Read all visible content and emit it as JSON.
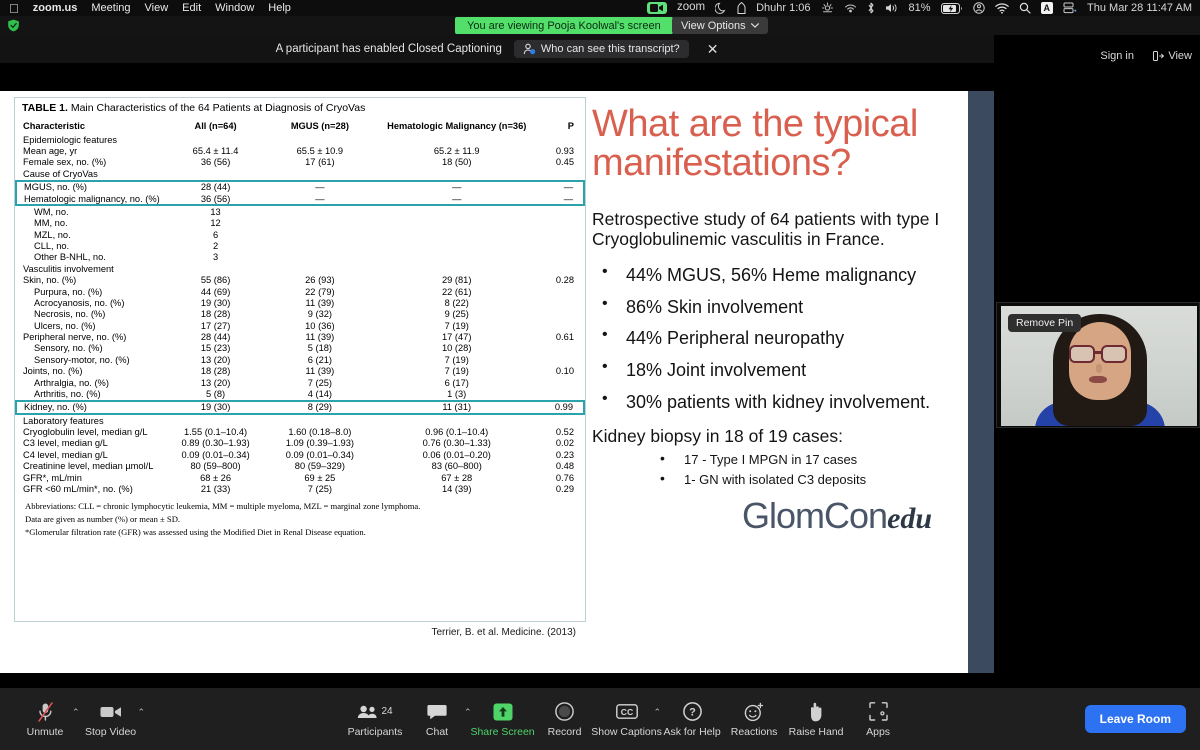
{
  "mac_menu": {
    "apple_icon": "apple-icon",
    "items": [
      "zoom.us",
      "Meeting",
      "View",
      "Edit",
      "Window",
      "Help"
    ],
    "status": {
      "zoom_label": "zoom",
      "prayer_label": "Dhuhr 1:06",
      "battery_pct": "81%",
      "keyboard_badge": "A",
      "datetime": "Thu Mar 28  11:47 AM"
    },
    "status_icons": [
      "zoom-video-icon",
      "zoom-wordmark",
      "crescent-icon",
      "mosque-icon",
      "weather-icon",
      "airplay-icon",
      "bluetooth-icon",
      "volume-icon",
      "battery-icon",
      "control-center-icon",
      "wifi-icon",
      "spotlight-search-icon",
      "keyboard-input-icon",
      "screen-share-icon"
    ]
  },
  "share_bar": {
    "shield_icon": "security-shield-icon",
    "viewing_banner": "You are viewing Pooja Koolwal's screen",
    "view_options": "View Options",
    "view_options_caret": "chevron-down-icon",
    "sign_in": "Sign in",
    "view_button": "View"
  },
  "caption_notice": {
    "message": "A participant has enabled Closed Captioning",
    "pill_label": "Who can see this transcript?",
    "pill_icon": "person-info-icon",
    "close_icon": "close-icon"
  },
  "slide": {
    "table": {
      "title_prefix": "TABLE 1.",
      "title": "Main Characteristics of the 64 Patients at Diagnosis of CryoVas",
      "columns": [
        "Characteristic",
        "All (n=64)",
        "MGUS (n=28)",
        "Hematologic Malignancy (n=36)",
        "P"
      ],
      "rows": [
        {
          "label": "Epidemiologic features",
          "indent": 0,
          "all": "",
          "mgus": "",
          "hm": "",
          "p": ""
        },
        {
          "label": "Mean age, yr",
          "indent": 0,
          "all": "65.4 ± 11.4",
          "mgus": "65.5 ± 10.9",
          "hm": "65.2 ± 11.9",
          "p": "0.93"
        },
        {
          "label": "Female sex, no. (%)",
          "indent": 0,
          "all": "36 (56)",
          "mgus": "17 (61)",
          "hm": "18 (50)",
          "p": "0.45"
        },
        {
          "label": "Cause of CryoVas",
          "indent": 0,
          "all": "",
          "mgus": "",
          "hm": "",
          "p": ""
        },
        {
          "label": "MGUS, no. (%)",
          "indent": 0,
          "all": "28 (44)",
          "mgus": "—",
          "hm": "—",
          "p": "—",
          "highlight": "top"
        },
        {
          "label": "Hematologic malignancy, no. (%)",
          "indent": 0,
          "all": "36 (56)",
          "mgus": "—",
          "hm": "—",
          "p": "—",
          "highlight": "bottom"
        },
        {
          "label": "WM, no.",
          "indent": 1,
          "all": "13",
          "mgus": "",
          "hm": "",
          "p": ""
        },
        {
          "label": "MM, no.",
          "indent": 1,
          "all": "12",
          "mgus": "",
          "hm": "",
          "p": ""
        },
        {
          "label": "MZL, no.",
          "indent": 1,
          "all": "6",
          "mgus": "",
          "hm": "",
          "p": ""
        },
        {
          "label": "CLL, no.",
          "indent": 1,
          "all": "2",
          "mgus": "",
          "hm": "",
          "p": ""
        },
        {
          "label": "Other B-NHL, no.",
          "indent": 1,
          "all": "3",
          "mgus": "",
          "hm": "",
          "p": ""
        },
        {
          "label": "Vasculitis involvement",
          "indent": 0,
          "all": "",
          "mgus": "",
          "hm": "",
          "p": ""
        },
        {
          "label": "Skin, no. (%)",
          "indent": 0,
          "all": "55 (86)",
          "mgus": "26 (93)",
          "hm": "29 (81)",
          "p": "0.28"
        },
        {
          "label": "Purpura, no. (%)",
          "indent": 1,
          "all": "44 (69)",
          "mgus": "22 (79)",
          "hm": "22 (61)",
          "p": ""
        },
        {
          "label": "Acrocyanosis, no. (%)",
          "indent": 1,
          "all": "19 (30)",
          "mgus": "11 (39)",
          "hm": "8 (22)",
          "p": ""
        },
        {
          "label": "Necrosis, no. (%)",
          "indent": 1,
          "all": "18 (28)",
          "mgus": "9 (32)",
          "hm": "9 (25)",
          "p": ""
        },
        {
          "label": "Ulcers, no. (%)",
          "indent": 1,
          "all": "17 (27)",
          "mgus": "10 (36)",
          "hm": "7 (19)",
          "p": ""
        },
        {
          "label": "Peripheral nerve, no. (%)",
          "indent": 0,
          "all": "28 (44)",
          "mgus": "11 (39)",
          "hm": "17 (47)",
          "p": "0.61"
        },
        {
          "label": "Sensory, no. (%)",
          "indent": 1,
          "all": "15 (23)",
          "mgus": "5 (18)",
          "hm": "10 (28)",
          "p": ""
        },
        {
          "label": "Sensory-motor, no. (%)",
          "indent": 1,
          "all": "13 (20)",
          "mgus": "6 (21)",
          "hm": "7 (19)",
          "p": ""
        },
        {
          "label": "Joints, no. (%)",
          "indent": 0,
          "all": "18 (28)",
          "mgus": "11 (39)",
          "hm": "7 (19)",
          "p": "0.10"
        },
        {
          "label": "Arthralgia, no. (%)",
          "indent": 1,
          "all": "13 (20)",
          "mgus": "7 (25)",
          "hm": "6 (17)",
          "p": ""
        },
        {
          "label": "Arthritis, no. (%)",
          "indent": 1,
          "all": "5 (8)",
          "mgus": "4 (14)",
          "hm": "1 (3)",
          "p": ""
        },
        {
          "label": "Kidney, no. (%)",
          "indent": 0,
          "all": "19 (30)",
          "mgus": "8 (29)",
          "hm": "11 (31)",
          "p": "0.99",
          "highlight": "both"
        },
        {
          "label": "Laboratory features",
          "indent": 0,
          "all": "",
          "mgus": "",
          "hm": "",
          "p": ""
        },
        {
          "label": "Cryoglobulin level, median g/L",
          "indent": 0,
          "all": "1.55 (0.1–10.4)",
          "mgus": "1.60 (0.18–8.0)",
          "hm": "0.96 (0.1–10.4)",
          "p": "0.52"
        },
        {
          "label": "C3 level, median g/L",
          "indent": 0,
          "all": "0.89 (0.30–1.93)",
          "mgus": "1.09 (0.39–1.93)",
          "hm": "0.76 (0.30–1.33)",
          "p": "0.02"
        },
        {
          "label": "C4 level, median g/L",
          "indent": 0,
          "all": "0.09 (0.01–0.34)",
          "mgus": "0.09 (0.01–0.34)",
          "hm": "0.06 (0.01–0.20)",
          "p": "0.23"
        },
        {
          "label": "Creatinine level, median µmol/L",
          "indent": 0,
          "all": "80 (59–800)",
          "mgus": "80 (59–329)",
          "hm": "83 (60–800)",
          "p": "0.48"
        },
        {
          "label": "GFR*, mL/min",
          "indent": 0,
          "all": "68 ± 26",
          "mgus": "69 ± 25",
          "hm": "67 ± 28",
          "p": "0.76"
        },
        {
          "label": "GFR <60 mL/min*, no. (%)",
          "indent": 0,
          "all": "21 (33)",
          "mgus": "7 (25)",
          "hm": "14 (39)",
          "p": "0.29"
        }
      ],
      "notes": [
        "Abbreviations: CLL = chronic lymphocytic leukemia, MM = multiple myeloma, MZL = marginal zone lymphoma.",
        "Data are given as number (%) or mean ± SD.",
        "*Glomerular filtration rate (GFR) was assessed using the Modified Diet in Renal Disease equation."
      ],
      "highlight_color": "#2aa3ad"
    },
    "citation": "Terrier, B. et al. Medicine. (2013)",
    "title": "What are the typical manifestations?",
    "title_color": "#d9604f",
    "lead": "Retrospective study of 64 patients with type I Cryoglobulinemic vasculitis in France.",
    "bullets": [
      "44% MGUS, 56% Heme malignancy",
      "86% Skin involvement",
      "44% Peripheral neuropathy",
      "18% Joint involvement",
      "30% patients with kidney involvement."
    ],
    "kidney_heading": "Kidney biopsy in 18 of 19 cases:",
    "kidney_sub": [
      "17 - Type I MPGN in 17 cases",
      "1- GN with isolated C3 deposits"
    ],
    "logo_main": "GlomCon",
    "logo_suffix": "edu"
  },
  "thumbnail": {
    "remove_pin": "Remove Pin"
  },
  "toolbar": {
    "items": [
      {
        "label": "Unmute",
        "icon": "microphone-muted-icon",
        "caret": true,
        "green": false
      },
      {
        "label": "Stop Video",
        "icon": "video-camera-icon",
        "caret": true,
        "green": false
      },
      {
        "label": "Participants",
        "icon": "participants-icon",
        "caret": false,
        "green": false,
        "count": "24"
      },
      {
        "label": "Chat",
        "icon": "chat-bubble-icon",
        "caret": true,
        "green": false
      },
      {
        "label": "Share Screen",
        "icon": "share-screen-up-arrow-icon",
        "caret": false,
        "green": true
      },
      {
        "label": "Record",
        "icon": "record-circle-icon",
        "caret": false,
        "green": false
      },
      {
        "label": "Show Captions",
        "icon": "closed-captions-icon",
        "caret": true,
        "green": false
      },
      {
        "label": "Ask for Help",
        "icon": "question-mark-icon",
        "caret": false,
        "green": false
      },
      {
        "label": "Reactions",
        "icon": "smiley-reaction-icon",
        "caret": false,
        "green": false
      },
      {
        "label": "Raise Hand",
        "icon": "raised-hand-icon",
        "caret": false,
        "green": false
      },
      {
        "label": "Apps",
        "icon": "apps-icon",
        "caret": false,
        "green": false
      }
    ],
    "leave_room": "Leave Room",
    "leave_color": "#2d72f3"
  }
}
